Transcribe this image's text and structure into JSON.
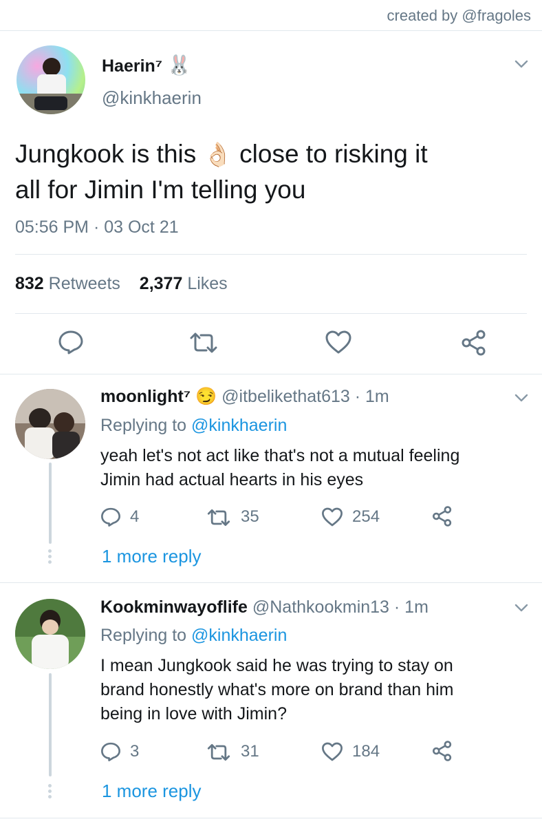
{
  "credit": "created by @fragoles",
  "main_tweet": {
    "display_name": "Haerin⁷",
    "name_emoji": "🐰",
    "handle": "@kinkhaerin",
    "text_line1_a": "Jungkook is this",
    "text_emoji": "👌🏻",
    "text_line1_b": "close to risking it",
    "text_line2": "all for Jimin I'm telling you",
    "timestamp": "05:56 PM · 03 Oct 21",
    "retweets_count": "832",
    "retweets_label": "Retweets",
    "likes_count": "2,377",
    "likes_label": "Likes"
  },
  "replies": [
    {
      "display_name": "moonlight⁷",
      "name_emoji": "😏",
      "handle_time": "@itbelikethat613 · 1m",
      "replying_prefix": "Replying to",
      "replying_to": "@kinkhaerin",
      "lines": [
        "yeah let's not act like that's not a mutual feeling",
        "Jimin had actual hearts in his eyes"
      ],
      "replies": "4",
      "retweets": "35",
      "likes": "254",
      "more": "1 more reply"
    },
    {
      "display_name": "Kookminwayoflife",
      "handle_time": "@Nathkookmin13 · 1m",
      "replying_prefix": "Replying to",
      "replying_to": "@kinkhaerin",
      "lines": [
        "I mean Jungkook said he was trying to stay on",
        "brand honestly what's more on brand than him",
        "being in love with Jimin?"
      ],
      "replies": "3",
      "retweets": "31",
      "likes": "184",
      "more": "1 more reply"
    }
  ],
  "colors": {
    "accent": "#1b95e0",
    "secondary_text": "#657786",
    "divider": "#e1e8ed"
  }
}
